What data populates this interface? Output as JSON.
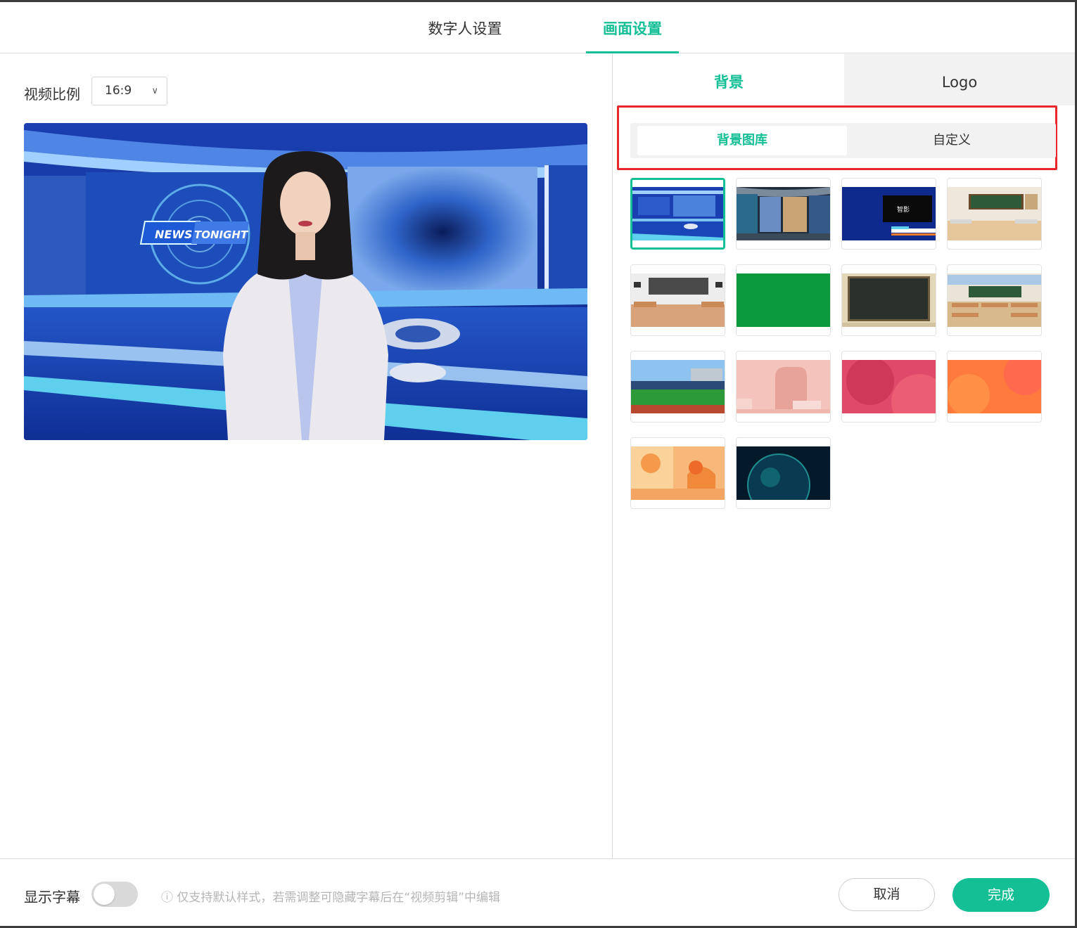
{
  "tabs": {
    "digital_human": "数字人设置",
    "scene": "画面设置"
  },
  "left": {
    "ratio_label": "视频比例",
    "ratio_value": "16:9",
    "preview_banner": {
      "news": "NEWS",
      "tonight": "TONIGHT"
    }
  },
  "right": {
    "tab_background": "背景",
    "tab_logo": "Logo",
    "seg_library": "背景图库",
    "seg_custom": "自定义",
    "thumb_logo_text": "智影"
  },
  "bottom": {
    "subtitle_label": "显示字幕",
    "hint": "ⓘ 仅支持默认样式，若需调整可隐藏字幕后在“视频剪辑”中编辑",
    "cancel": "取消",
    "done": "完成"
  },
  "colors": {
    "accent": "#14bf96",
    "highlight_border": "#e8262b"
  }
}
